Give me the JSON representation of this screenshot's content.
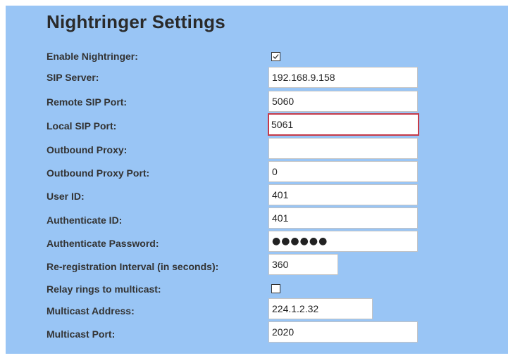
{
  "page": {
    "title": "Nightringer Settings"
  },
  "fields": {
    "enable_nightringer": {
      "label": "Enable Nightringer:",
      "checked": true
    },
    "sip_server": {
      "label": "SIP Server:",
      "value": "192.168.9.158"
    },
    "remote_sip_port": {
      "label": "Remote SIP Port:",
      "value": "5060"
    },
    "local_sip_port": {
      "label": "Local SIP Port:",
      "value": "5061",
      "highlight_color": "#c63a48"
    },
    "outbound_proxy": {
      "label": "Outbound Proxy:",
      "value": ""
    },
    "outbound_proxy_port": {
      "label": "Outbound Proxy Port:",
      "value": "0"
    },
    "user_id": {
      "label": "User ID:",
      "value": "401"
    },
    "authenticate_id": {
      "label": "Authenticate ID:",
      "value": "401"
    },
    "authenticate_password": {
      "label": "Authenticate Password:",
      "masked_value": "●●●●●●"
    },
    "reregistration_interval": {
      "label": "Re-registration Interval (in seconds):",
      "value": "360"
    },
    "relay_rings_to_multicast": {
      "label": "Relay rings to multicast:",
      "checked": false
    },
    "multicast_address": {
      "label": "Multicast Address:",
      "value": "224.1.2.32"
    },
    "multicast_port": {
      "label": "Multicast Port:",
      "value": "2020"
    }
  },
  "colors": {
    "panel_background": "#99c5f5",
    "highlight_border": "#c63a48"
  }
}
